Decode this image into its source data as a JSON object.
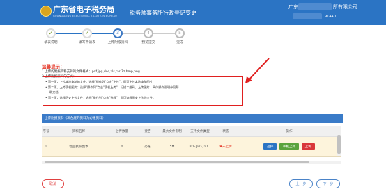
{
  "header": {
    "site_name": "广东省电子税务局",
    "site_name_en": "GUANGDONG ELECTRONIC TAXATION BUREAU",
    "page_title": "税务师事务所行政登记变更",
    "company_prefix": "广东",
    "company_suffix": "所有限公司",
    "tax_id_suffix": "91440"
  },
  "steps": [
    {
      "label": "填表说明",
      "status": "done",
      "num": "1"
    },
    {
      "label": "填写申请表",
      "status": "done",
      "num": "2"
    },
    {
      "label": "上传附报资料",
      "status": "active",
      "num": "3"
    },
    {
      "label": "预览提交",
      "status": "todo",
      "num": "4"
    },
    {
      "label": "完成",
      "status": "todo",
      "num": "5"
    }
  ],
  "colors": {
    "accent": "#2b74c4",
    "done": "#7a9a2a",
    "danger": "#e02020",
    "success": "#5aa33c"
  },
  "hint": {
    "title": "温馨提示：",
    "line1": "1.上传的附报资料支持的文件格式：pdf,jpg,doc,xls,rar,7z,bmp,png",
    "line2": "2.上传附报资料的方式：",
    "bullets": [
      "第一项，上传本地电脑的文件：选择\"操作列\"点击\"上传\"，即可上传本地电脑图片;",
      "第二项，上传手机图片：选择\"操作列\"点击\"手机上传\"，扫描二维码，上传图片，具体操作说明参见帮",
      "助文档;",
      "第三项，选择历史上传文件：选择\"操作列\"点击\"选择\"，即可选择历史上传的文件。"
    ]
  },
  "section": {
    "title": "上传附报资料（灰色底的资料为必报资料）"
  },
  "table": {
    "columns": [
      "序号",
      "资料名称",
      "上传数量",
      "要否",
      "最大文件限制",
      "支持文件类型",
      "状态",
      "操作"
    ],
    "rows": [
      {
        "index": "1",
        "name": "营业执照副本",
        "count": "0",
        "required": "必报",
        "max_size": "5M",
        "types": "PDF,JPG,DO...",
        "status": "未上传"
      }
    ],
    "actions": {
      "select": "选择",
      "mobile": "手机上传",
      "upload": "上传"
    }
  },
  "footer": {
    "cancel": "取消",
    "prev": "上一步",
    "next": "下一步"
  }
}
